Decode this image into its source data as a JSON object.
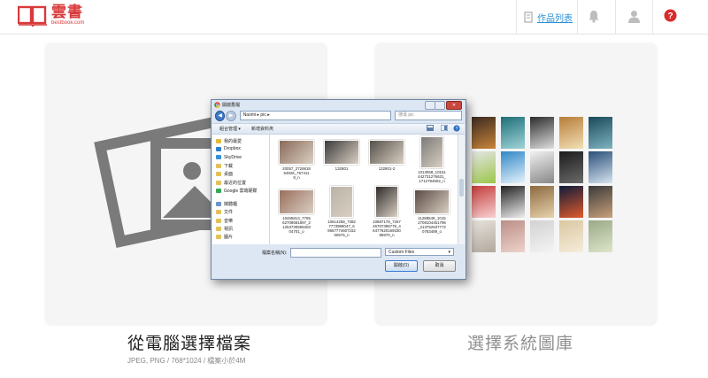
{
  "header": {
    "logo_title": "雲書",
    "logo_subtitle": "bestbook.com",
    "works_list_label": "作品列表"
  },
  "upload_options": {
    "computer": {
      "title": "從電腦選擇檔案",
      "note": "JPEG, PNG / 768*1024 / 檔案小於4M"
    },
    "library": {
      "title": "選擇系統圖庫"
    }
  },
  "file_dialog": {
    "title": "開啟舊檔",
    "address_path": "Naomi ▸ pic ▸",
    "search_placeholder": "搜尋 pic",
    "toolbar": {
      "organize": "組合管理 ▾",
      "new_folder": "新增資料夾"
    },
    "nav_items": [
      {
        "label": "我的最愛",
        "icon": "star"
      },
      {
        "label": "Dropbox",
        "icon": "dropbox"
      },
      {
        "label": "SkyDrive",
        "icon": "cloud"
      },
      {
        "label": "下載",
        "icon": "folder"
      },
      {
        "label": "桌面",
        "icon": "folder"
      },
      {
        "label": "最近的位置",
        "icon": "folder"
      },
      {
        "label": "Google 雲端硬碟",
        "icon": "drive"
      },
      {
        "label": "媒體櫃",
        "icon": "library"
      },
      {
        "label": "文件",
        "icon": "folder"
      },
      {
        "label": "音樂",
        "icon": "folder"
      },
      {
        "label": "視訊",
        "icon": "folder"
      },
      {
        "label": "圖片",
        "icon": "folder"
      }
    ],
    "files": [
      {
        "name": "20057_2726818\n54926_767411\n8_n",
        "shape": "landscape"
      },
      {
        "name": "132801",
        "shape": "landscape"
      },
      {
        "name": "132801-2",
        "shape": "landscape"
      },
      {
        "name": "1013058_10151\n442731276631_\n1712794902_n",
        "shape": "portrait"
      },
      {
        "name": "10465813_7765\n62709681897_2\n1253730596303\n04701_o",
        "shape": "landscape"
      },
      {
        "name": "10614258_7382\n7773988047_6\n9657774607152\n50575_n",
        "shape": "portrait"
      },
      {
        "name": "10887178_7267\n45707395778_4\n6477620169330\n86970_n",
        "shape": "portrait"
      },
      {
        "name": "11289549_1015\n2708104451796\n_213752537772\n0783489_o",
        "shape": "landscape"
      }
    ],
    "filename_label": "檔案名稱(N):",
    "filename_value": "",
    "filetype_value": "Custom Files",
    "open_button": "開啟(O)",
    "cancel_button": "取消"
  },
  "colors": {
    "brand_red": "#d83a3a",
    "link_blue": "#2a8fd6",
    "help_red": "#d92b2b",
    "panel_bg": "#f5f5f5",
    "placeholder_icon": "#7a7a7a"
  }
}
